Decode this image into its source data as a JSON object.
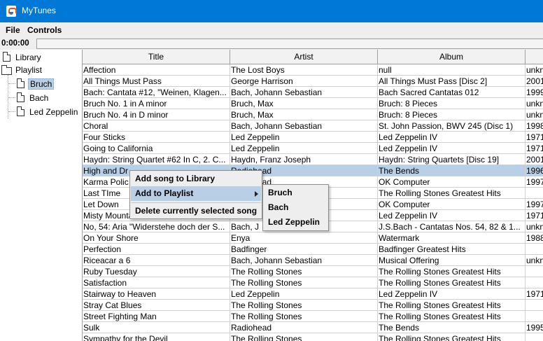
{
  "window": {
    "title": "MyTunes",
    "icon": "java-cup-icon"
  },
  "menubar": {
    "items": [
      "File",
      "Controls"
    ]
  },
  "player": {
    "time": "0:00:00",
    "progress": 0
  },
  "tree": {
    "library_label": "Library",
    "playlist_label": "Playlist",
    "playlists": [
      "Bruch",
      "Bach",
      "Led Zeppelin"
    ],
    "selected_playlist": "Bruch"
  },
  "table": {
    "columns": [
      "Title",
      "Artist",
      "Album",
      ""
    ],
    "selected_row": 9,
    "rows": [
      [
        "Affection",
        "The Lost Boys",
        "null",
        "unkn"
      ],
      [
        "All Things Must Pass",
        "George Harrison",
        "All Things Must Pass [Disc 2]",
        "2001"
      ],
      [
        "Bach: Cantata #12, \"Weinen, Klagen...",
        "Bach, Johann Sebastian",
        "Bach Sacred Cantatas 012",
        "1999"
      ],
      [
        "Bruch No. 1 in A minor",
        "Bruch, Max",
        "Bruch: 8 Pieces",
        "unkn"
      ],
      [
        "Bruch No. 4 in D minor",
        "Bruch, Max",
        "Bruch: 8 Pieces",
        "unkn"
      ],
      [
        "Choral",
        "Bach, Johann Sebastian",
        "St. John Passion, BWV 245 (Disc 1)",
        "1998"
      ],
      [
        "Four Sticks",
        "Led Zeppelin",
        "Led Zeppelin IV",
        "1971"
      ],
      [
        "Going to California",
        "Led Zeppelin",
        "Led Zeppelin IV",
        "1971"
      ],
      [
        "Haydn: String Quartet #62 In C, 2. C...",
        "Haydn, Franz Joseph",
        "Haydn: String Quartets [Disc 19]",
        "2001"
      ],
      [
        "High and Dr",
        "Radiohead",
        "The Bends",
        "1996"
      ],
      [
        "Karma Polic",
        "Radiohead",
        "OK Computer",
        "1997"
      ],
      [
        "Last TIme",
        "",
        "The Rolling Stones Greatest Hits",
        ""
      ],
      [
        "Let Down",
        "",
        "OK Computer",
        "1997"
      ],
      [
        "Misty Mounta",
        "",
        "Led Zeppelin IV",
        "1971"
      ],
      [
        "No, 54: Aria \"Widerstehe doch der S...",
        "Bach, J",
        "J.S.Bach - Cantatas Nos. 54, 82 & 1...",
        "unkn"
      ],
      [
        "On Your Shore",
        "Enya",
        "Watermark",
        "1988"
      ],
      [
        "Perfection",
        "Badfinger",
        "Badfinger Greatest Hits",
        ""
      ],
      [
        "Riceacar a 6",
        "Bach, Johann Sebastian",
        "Musical Offering",
        "unkn"
      ],
      [
        "Ruby Tuesday",
        "The Rolling Stones",
        "The Rolling Stones Greatest Hits",
        ""
      ],
      [
        "Satisfaction",
        "The Rolling Stones",
        "The Rolling Stones Greatest Hits",
        ""
      ],
      [
        "Stairway to Heaven",
        "Led Zeppelin",
        "Led Zeppelin IV",
        "1971"
      ],
      [
        "Stray Cat Blues",
        "The Rolling Stones",
        "The Rolling Stones Greatest Hits",
        ""
      ],
      [
        "Street Fighting Man",
        "The Rolling Stones",
        "The Rolling Stones Greatest Hits",
        ""
      ],
      [
        "Sulk",
        "Radiohead",
        "The Bends",
        "1995"
      ],
      [
        "Sympathy for the Devil",
        "The Rolling Stones",
        "The Rolling Stones Greatest Hits",
        ""
      ]
    ]
  },
  "context_menu": {
    "items": [
      "Add song to Library",
      "Add to Playlist",
      "Delete currently selected song"
    ],
    "active_item": "Add to Playlist",
    "submenu": [
      "Bruch",
      "Bach",
      "Led Zeppelin"
    ]
  },
  "colors": {
    "titlebar": "#0078d7",
    "selection": "#b8cfe5",
    "chrome": "#eeeeee"
  }
}
